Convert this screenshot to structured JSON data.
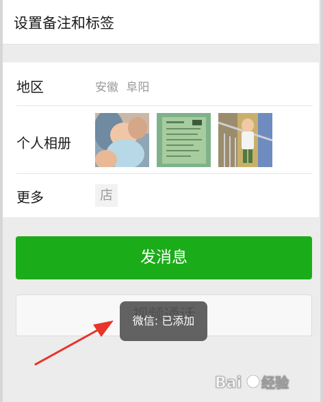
{
  "remark": {
    "label": "设置备注和标签"
  },
  "info": {
    "region": {
      "label": "地区",
      "value": "安徽 阜阳"
    },
    "album": {
      "label": "个人相册",
      "photos": [
        "baby-photo",
        "document-photo",
        "child-on-stairs-photo"
      ]
    },
    "more": {
      "label": "更多",
      "store_glyph": "店"
    }
  },
  "actions": {
    "send_message": "发消息",
    "video_call": "视频通话"
  },
  "toast": {
    "text": "微信: 已添加"
  },
  "annotation": {
    "arrow_color": "#e8352b"
  },
  "watermark": {
    "brand": "Baidu经验"
  },
  "colors": {
    "primary_green": "#1aad19",
    "toast_bg": "#555555"
  }
}
